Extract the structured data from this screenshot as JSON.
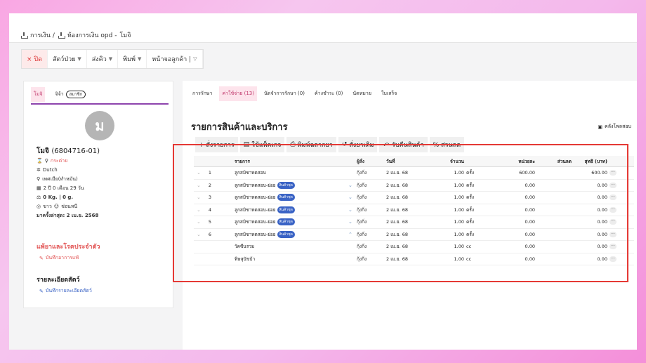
{
  "breadcrumb": {
    "root": "การเงิน /",
    "page": "ห้องการเงิน opd -",
    "pet": "โมจิ"
  },
  "toolbar": {
    "close": "× ปิด",
    "items": [
      "สัตว์ป่วย",
      "ส่งคิว",
      "พิมพ์",
      "หน้าจอลูกค้า |"
    ]
  },
  "patient": {
    "tab_active": "โมจิ",
    "tab_other": "จิจ้า",
    "tab_other_badge": "สมาชิก",
    "avatar_letter": "ม",
    "name": "โมจิ",
    "id": "(6804716-01)",
    "status": "กระต่าย",
    "breed": "Dutch",
    "location": "เพศเมีย(ทำหมัน)",
    "age": "2 ปี 0 เดือน 29 วัน",
    "weight": "0 Kg. | 0 g.",
    "color": "ขาว",
    "marking": "ช่อนหนี",
    "last_visit": "มาครั้งล่าสุด: 2 เม.ย. 2568",
    "allergy_title": "แพ้ยาและโรคประจำตัว",
    "allergy_link": "บันทึกอาการแพ้",
    "detail_title": "รายละเอียดสัตว์",
    "detail_link": "บันทึกรายละเอียดสัตว์"
  },
  "main": {
    "tabs": [
      "การรักษา",
      "ค่าใช้จ่าย (13)",
      "นัดจำการรักษา (0)",
      "ค้างชำระ (0)",
      "นัดหมาย",
      "ใบเสร็จ"
    ],
    "title": "รายการสินค้าและบริการ",
    "print_label": "คลังโพลสอบ",
    "actions": [
      "+ สั่งรายการ",
      "ใช้แพ็คเกจ",
      "พิมพ์ฉลากยา",
      "สั่งยาเดิม",
      "รับคืนสินค้า",
      "% ส่วนลด"
    ],
    "columns": [
      "รายการ",
      "ผู้สั่ง",
      "วันที่",
      "จำนวน",
      "หน่วยละ",
      "ส่วนลด",
      "สุทธิ (บาท)"
    ],
    "rows": [
      {
        "no": "1",
        "item": "ลูกสมิชาทดสอบ",
        "tag": "",
        "by": "กุ้งกิ่ง",
        "date": "2 เม.ย. 68",
        "qty": "1.00",
        "unit": "ครั้ง",
        "price": "600.00",
        "disc": "",
        "net": "600.00",
        "chev": ""
      },
      {
        "no": "2",
        "item": "ลูกสมิชาทดสอบ-ย่อย",
        "tag": "สินค้าชุด",
        "by": "กุ้งกิ่ง",
        "date": "2 เม.ย. 68",
        "qty": "1.00",
        "unit": "ครั้ง",
        "price": "0.00",
        "disc": "",
        "net": "0.00",
        "chev": "⌄"
      },
      {
        "no": "3",
        "item": "ลูกสมิชาทดสอบ-ย่อย",
        "tag": "สินค้าชุด",
        "by": "กุ้งกิ่ง",
        "date": "2 เม.ย. 68",
        "qty": "1.00",
        "unit": "ครั้ง",
        "price": "0.00",
        "disc": "",
        "net": "0.00",
        "chev": "⌄"
      },
      {
        "no": "4",
        "item": "ลูกสมิชาทดสอบ-ย่อย",
        "tag": "สินค้าชุด",
        "by": "กุ้งกิ่ง",
        "date": "2 เม.ย. 68",
        "qty": "1.00",
        "unit": "ครั้ง",
        "price": "0.00",
        "disc": "",
        "net": "0.00",
        "chev": "⌄"
      },
      {
        "no": "5",
        "item": "ลูกสมิชาทดสอบ-ย่อย",
        "tag": "สินค้าชุด",
        "by": "กุ้งกิ่ง",
        "date": "2 เม.ย. 68",
        "qty": "1.00",
        "unit": "ครั้ง",
        "price": "0.00",
        "disc": "",
        "net": "0.00",
        "chev": "⌄"
      },
      {
        "no": "6",
        "item": "ลูกสมิชาทดสอบ-ย่อย",
        "tag": "สินค้าชุด",
        "by": "กุ้งกิ่ง",
        "date": "2 เม.ย. 68",
        "qty": "1.00",
        "unit": "ครั้ง",
        "price": "0.00",
        "disc": "",
        "net": "0.00",
        "chev": "⌃"
      },
      {
        "no": "",
        "item": "วัคซีนรวม",
        "tag": "",
        "by": "กุ้งกิ่ง",
        "date": "2 เม.ย. 68",
        "qty": "1.00",
        "unit": "cc",
        "price": "0.00",
        "disc": "",
        "net": "0.00",
        "chev": ""
      },
      {
        "no": "",
        "item": "พิษสุนัขบ้า",
        "tag": "",
        "by": "กุ้งกิ่ง",
        "date": "2 เม.ย. 68",
        "qty": "1.00",
        "unit": "cc",
        "price": "0.00",
        "disc": "",
        "net": "0.00",
        "chev": ""
      }
    ]
  }
}
